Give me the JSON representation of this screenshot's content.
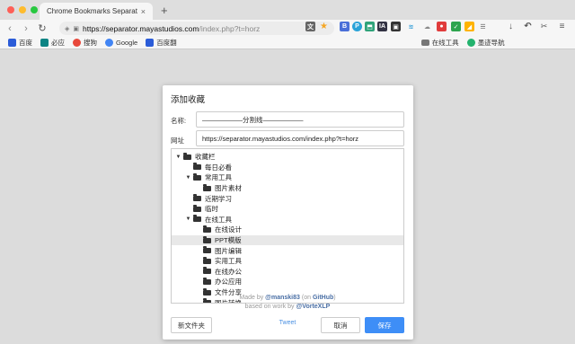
{
  "browser": {
    "tab_title": "Chrome Bookmarks Separator",
    "tab_close": "×",
    "new_tab": "+",
    "url_host": "https://separator.mayastudios.com",
    "url_path": "/index.php?t=horz"
  },
  "bookmarks_bar": [
    {
      "label": "百度",
      "color": "#2b5cd8"
    },
    {
      "label": "必应",
      "color": "#0c8484"
    },
    {
      "label": "搜狗",
      "color": "#e8483b"
    },
    {
      "label": "Google",
      "color": "#4285f4"
    },
    {
      "label": "百度翻",
      "color": "#2b5cd8"
    },
    {
      "label": "在线工具",
      "color": "#666666"
    },
    {
      "label": "墨迹导航",
      "color": "#23b36e"
    }
  ],
  "dialog": {
    "title": "添加收藏",
    "name_label": "名称:",
    "name_value": "——————分割线——————",
    "url_label": "网址",
    "url_value": "https://separator.mayastudios.com/index.php?t=horz",
    "tree": [
      {
        "label": "收藏栏",
        "level": 0,
        "expanded": true
      },
      {
        "label": "每日必看",
        "level": 1,
        "expanded": false
      },
      {
        "label": "常用工具",
        "level": 1,
        "expanded": true
      },
      {
        "label": "图片素材",
        "level": 2,
        "expanded": false
      },
      {
        "label": "近期学习",
        "level": 1,
        "expanded": false
      },
      {
        "label": "临时",
        "level": 1,
        "expanded": false
      },
      {
        "label": "在线工具",
        "level": 1,
        "expanded": true
      },
      {
        "label": "在线设计",
        "level": 2,
        "expanded": false
      },
      {
        "label": "PPT模版",
        "level": 2,
        "expanded": false,
        "selected": true
      },
      {
        "label": "图片编辑",
        "level": 2,
        "expanded": false
      },
      {
        "label": "实用工具",
        "level": 2,
        "expanded": false
      },
      {
        "label": "在线办公",
        "level": 2,
        "expanded": false
      },
      {
        "label": "办公应用",
        "level": 2,
        "expanded": false
      },
      {
        "label": "文件分享",
        "level": 2,
        "expanded": false
      },
      {
        "label": "图片转换",
        "level": 2,
        "expanded": false
      }
    ],
    "new_folder_label": "新文件夹",
    "cancel_label": "取消",
    "save_label": "保存"
  },
  "footer": {
    "made_by_prefix": "Made by ",
    "made_by_user": "@manski83",
    "made_by_mid": " (on ",
    "made_by_site": "GitHub",
    "made_by_end": ")",
    "based_prefix": "based on work by ",
    "based_user": "@VorteXLP",
    "tweet_label": "Tweet"
  },
  "colors": {
    "primary_button": "#3e8ef7",
    "traffic_close": "#fe5f57",
    "traffic_min": "#febc2e",
    "traffic_max": "#28c840"
  }
}
